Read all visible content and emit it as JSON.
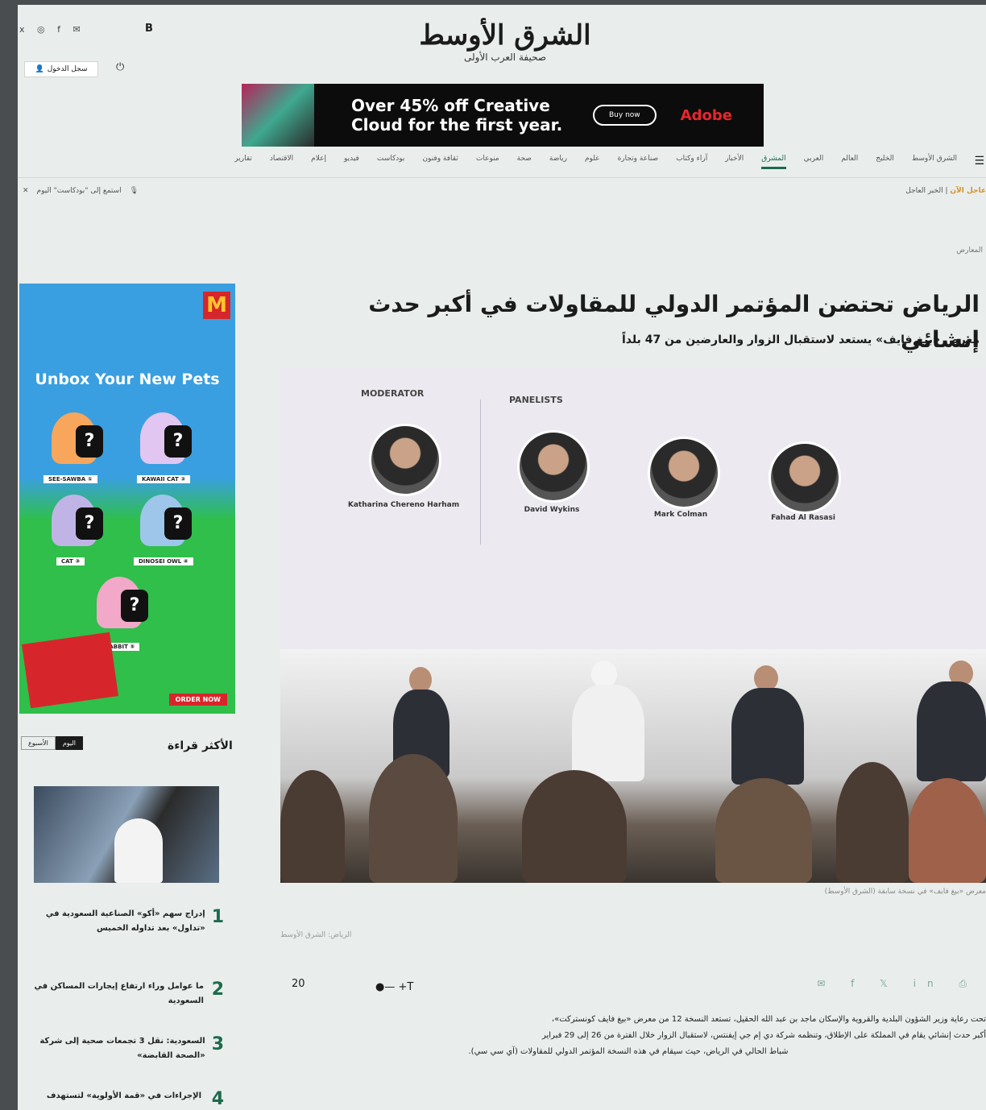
{
  "header": {
    "logo_text": "الشرق الأوسط",
    "tagline": "صحيفة العرب الأولى",
    "subscribe_label": "سجل الدخول",
    "top_left_icons": "x ◎ f ✉",
    "bold_b": "B"
  },
  "top_ad": {
    "headline": "Over 45% off Creative Cloud for the first year.",
    "button_label": "Buy now",
    "brand": "Adobe"
  },
  "nav": {
    "items": [
      "الشرق الأوسط",
      "الخليج",
      "العالم",
      "العربي",
      "المشرق",
      "الأخبار",
      "آراء وكتاب",
      "صناعة وتجارة",
      "علوم",
      "رياضة",
      "صحة",
      "منوعات",
      "ثقافة وفنون",
      "بودكاست",
      "فيديو",
      "إعلام",
      "الاقتصاد",
      "تقارير"
    ],
    "active_index": 4
  },
  "breaking": {
    "label": "عاجل الآن",
    "text": "الخبر العاجل"
  },
  "mode": {
    "label": "استمع إلى \"بودكاست\" اليوم"
  },
  "article": {
    "crumb": "المعارض",
    "title": "الرياض تحتضن المؤتمر الدولي للمقاولات في أكبر حدث إنشائي",
    "subtitle": "معرض «بيغ فايف» يستعد لاستقبال الزوار والعارضين من 47 بلداً",
    "hero": {
      "moderator_label": "MODERATOR",
      "panelists_label": "PANELISTS",
      "panelists": [
        "Katharina Chereno Harham",
        "David Wykins",
        "Mark Colman",
        "Fahad Al Rasasi"
      ]
    },
    "caption": "معرض «بيغ فايف» في نسخة سابقة (الشرق الأوسط)",
    "credit": "الرياض: الشرق الأوسط",
    "comment_count": "20",
    "font_scale": "+T",
    "share_icons": "✉ f 𝕏 in ⎙",
    "body": [
      "تحت رعاية وزير الشؤون البلدية والقروية والإسكان ماجد بن عبد الله الحقيل، تستعد النسخة 12 من معرض «بيغ فايف كونستركت»،",
      "أكبر حدث إنشائي يقام في المملكة على الإطلاق، وتنظمه شركة دي إم جي إيفنتس، لاستقبال الزوار خلال الفترة من 26 إلى 29 فبراير",
      "شباط الحالي في الرياض، حيث سيقام في هذه النسخة المؤتمر الدولي للمقاولات (آي سي سي)."
    ]
  },
  "side_ad": {
    "brand": "M",
    "title": "Unbox Your New Pets",
    "tags": [
      "SEE-SAWBA ①",
      "KAWAII CAT ②",
      "CAT ③",
      "DINOSEI OWL ④",
      "RABBIT ⑤"
    ],
    "shop_label": "ORDER NOW"
  },
  "most_read": {
    "title": "الأكثر قراءة",
    "tabs": [
      "اليوم",
      "الأسبوع"
    ],
    "items": [
      {
        "num": "1",
        "text": "إدراج سهم «أكو» الصناعية السعودية في «تداول» بعد تداوله الخميس"
      },
      {
        "num": "2",
        "text": "ما عوامل وراء ارتفاع إيجارات المساكن في السعودية"
      },
      {
        "num": "3",
        "text": "السعودية: نقل 3 تجمعات صحية إلى شركة «الصحة القابضة»"
      },
      {
        "num": "4",
        "text": "الإجراءات في «قمة الأولوية» لتستهدف"
      }
    ]
  },
  "colors": {
    "accent": "#1d6a4c",
    "ad_red": "#d7262b"
  }
}
